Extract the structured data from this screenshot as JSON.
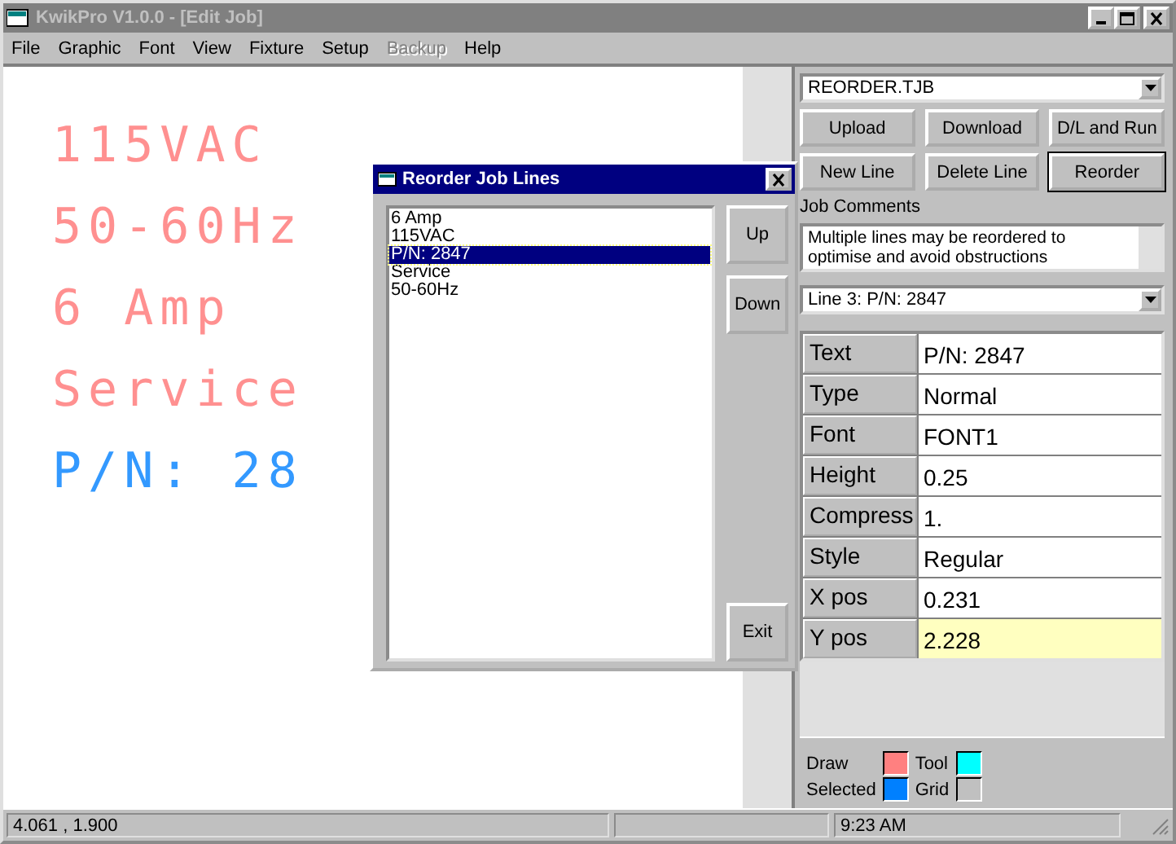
{
  "window": {
    "title": "KwikPro  V1.0.0 - [Edit Job]"
  },
  "menu": [
    {
      "label": "File",
      "disabled": false
    },
    {
      "label": "Graphic",
      "disabled": false
    },
    {
      "label": "Font",
      "disabled": false
    },
    {
      "label": "View",
      "disabled": false
    },
    {
      "label": "Fixture",
      "disabled": false
    },
    {
      "label": "Setup",
      "disabled": false
    },
    {
      "label": "Backup",
      "disabled": true
    },
    {
      "label": "Help",
      "disabled": false
    }
  ],
  "canvas": {
    "lines": [
      {
        "text": "115VAC",
        "selected": false
      },
      {
        "text": "50-60Hz",
        "selected": false
      },
      {
        "text": "6 Amp",
        "selected": false
      },
      {
        "text": "Service",
        "selected": false
      },
      {
        "text": "P/N: 28",
        "selected": true
      }
    ]
  },
  "dialog": {
    "title": "Reorder Job Lines",
    "items": [
      {
        "label": "6 Amp",
        "selected": false
      },
      {
        "label": "115VAC",
        "selected": false
      },
      {
        "label": "P/N: 2847",
        "selected": true
      },
      {
        "label": "Service",
        "selected": false
      },
      {
        "label": "50-60Hz",
        "selected": false
      }
    ],
    "buttons": [
      "Up",
      "Down",
      "Exit"
    ]
  },
  "panel": {
    "job_file": "REORDER.TJB",
    "buttons": [
      {
        "label": "Upload",
        "default": false
      },
      {
        "label": "Download",
        "default": false
      },
      {
        "label": "D/L and Run",
        "default": false
      },
      {
        "label": "New Line",
        "default": false
      },
      {
        "label": "Delete Line",
        "default": false
      },
      {
        "label": "Reorder",
        "default": true
      }
    ],
    "comments_label": "Job Comments",
    "comments": "Multiple lines may be reordered to optimise and avoid obstructions",
    "line_select": "Line 3: P/N: 2847",
    "properties": [
      {
        "name": "Text",
        "value": "P/N: 2847",
        "selected": false
      },
      {
        "name": "Type",
        "value": "Normal",
        "selected": false
      },
      {
        "name": "Font",
        "value": "FONT1",
        "selected": false
      },
      {
        "name": "Height",
        "value": "0.25",
        "selected": false
      },
      {
        "name": "Compress",
        "value": "1.",
        "selected": false
      },
      {
        "name": "Style",
        "value": "Regular",
        "selected": false
      },
      {
        "name": "X pos",
        "value": "0.231",
        "selected": false
      },
      {
        "name": "Y pos",
        "value": "2.228",
        "selected": true
      }
    ],
    "legend": [
      {
        "label": "Draw",
        "color": "#ff8080"
      },
      {
        "label": "Tool",
        "color": "#00ffff"
      },
      {
        "label": "Selected",
        "color": "#0080ff"
      },
      {
        "label": "Grid",
        "color": "#c0c0c0"
      }
    ]
  },
  "status_bar": {
    "coords": "4.061 , 1.900",
    "time": "9:23 AM"
  }
}
